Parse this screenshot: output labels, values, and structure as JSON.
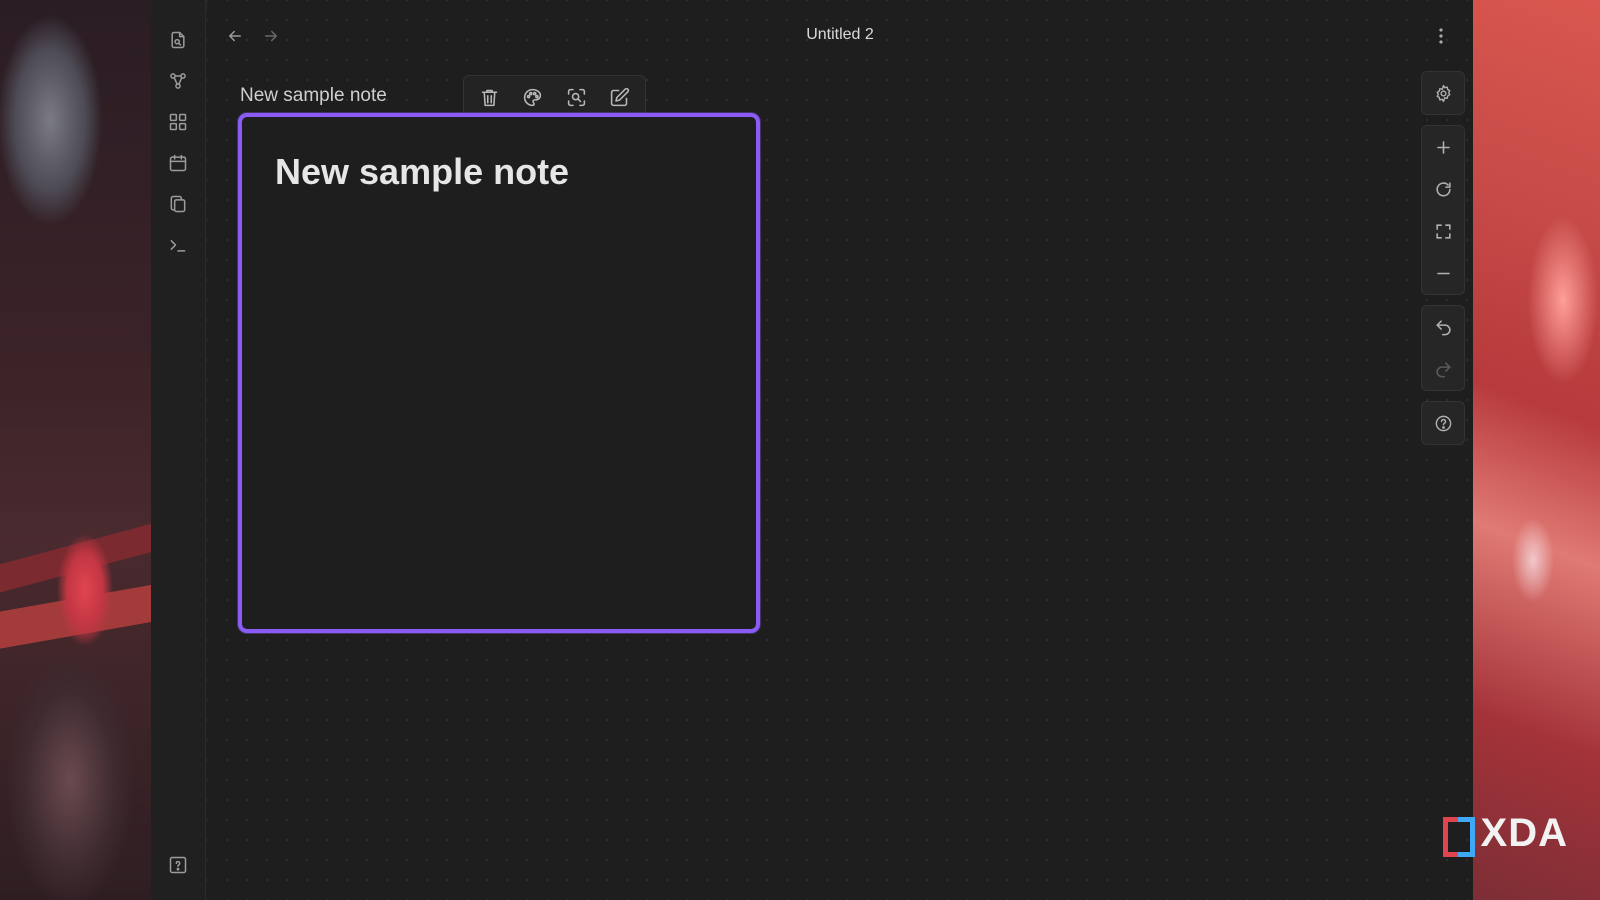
{
  "window": {
    "title": "Untitled 2"
  },
  "ribbon": {
    "items": [
      {
        "icon": "open-quick-switcher-icon"
      },
      {
        "icon": "graph-view-icon"
      },
      {
        "icon": "canvas-icon"
      },
      {
        "icon": "daily-note-calendar-icon"
      },
      {
        "icon": "templates-icon"
      },
      {
        "icon": "command-palette-icon"
      }
    ],
    "bottom_icon": "help-vault-icon"
  },
  "canvas": {
    "node": {
      "label": "New sample note",
      "heading": "New sample note",
      "border_color": "#8a5cf5"
    },
    "node_toolbar": [
      "trash-icon",
      "palette-icon",
      "zoom-to-selection-icon",
      "edit-icon"
    ],
    "controls": {
      "settings": "gear-icon",
      "zoom": [
        "zoom-in-icon",
        "reset-zoom-icon",
        "zoom-to-fit-icon",
        "zoom-out-icon"
      ],
      "history": [
        "undo-icon",
        "redo-icon"
      ],
      "help": "help-icon"
    }
  },
  "watermark": {
    "text": "XDA"
  }
}
